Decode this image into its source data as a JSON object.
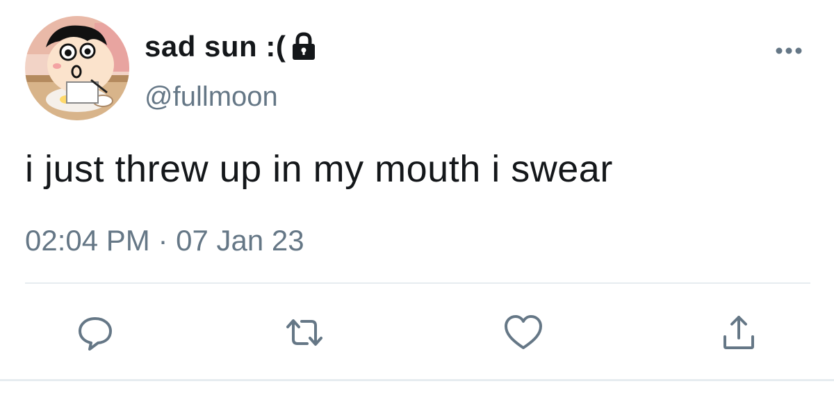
{
  "tweet": {
    "display_name": "sad sun :(",
    "handle": "@fullmoon",
    "protected_icon": "lock-icon",
    "text": "i just threw up in my mouth i swear",
    "timestamp": "02:04 PM · 07 Jan 23"
  },
  "actions": [
    {
      "icon": "reply-icon"
    },
    {
      "icon": "retweet-icon"
    },
    {
      "icon": "like-icon"
    },
    {
      "icon": "share-icon"
    }
  ],
  "colors": {
    "text_primary": "#14171a",
    "text_secondary": "#657786",
    "icon": "#657786",
    "divider": "#e6ecf0",
    "background": "#ffffff"
  }
}
